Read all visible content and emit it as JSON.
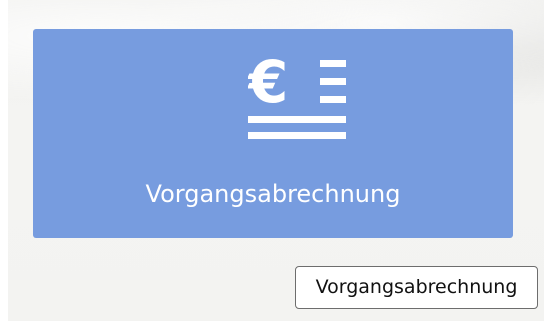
{
  "tile": {
    "label": "Vorgangsabrechnung",
    "icon": "euro-document-icon",
    "icon_glyph": "€",
    "background_color": "#779cdf"
  },
  "tooltip": {
    "text": "Vorgangsabrechnung"
  }
}
